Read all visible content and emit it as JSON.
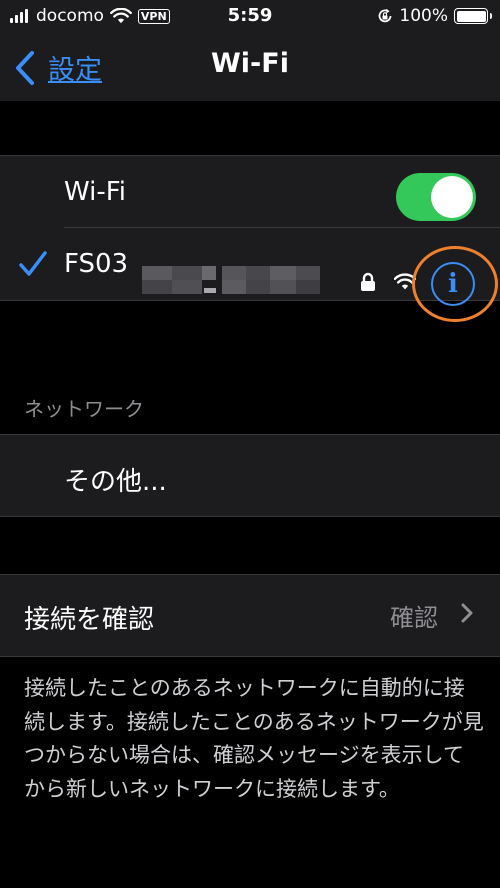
{
  "status_bar": {
    "carrier": "docomo",
    "vpn": "VPN",
    "time": "5:59",
    "battery_percent": "100%",
    "icons": [
      "signal-icon",
      "wifi-icon",
      "vpn-badge",
      "rotation-lock-icon",
      "battery-icon"
    ]
  },
  "nav": {
    "back_label": "設定",
    "title": "Wi-Fi"
  },
  "wifi_group": {
    "wifi_label": "Wi-Fi",
    "wifi_on": true,
    "connected_network": "FS03",
    "connected_network_redacted": true
  },
  "networks_section": {
    "header": "ネットワーク",
    "other_label": "その他..."
  },
  "ask_join": {
    "label": "接続を確認",
    "value": "確認",
    "description": "接続したことのあるネットワークに自動的に接続します。接続したことのあるネットワークが見つからない場合は、確認メッセージを表示してから新しいネットワークに接続します。"
  },
  "colors": {
    "accent": "#3a8ef6",
    "toggle_on": "#34c759",
    "highlight_ring": "#f0802e",
    "background": "#000000",
    "cell": "#1c1c1e"
  }
}
